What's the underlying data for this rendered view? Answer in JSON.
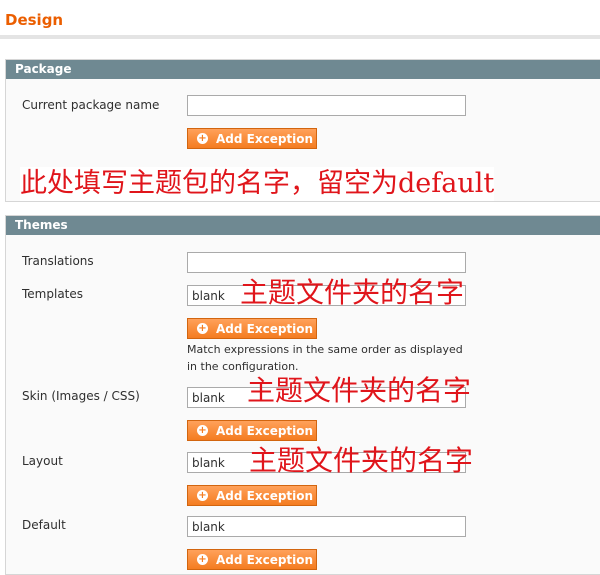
{
  "page": {
    "title": "Design"
  },
  "package_section": {
    "title": "Package",
    "current_package_label": "Current package name",
    "current_package_value": "",
    "add_exception_label": "Add Exception"
  },
  "themes_section": {
    "title": "Themes",
    "translations_label": "Translations",
    "translations_value": "",
    "templates_label": "Templates",
    "templates_value": "blank",
    "templates_hint": "Match expressions in the same order as displayed in the configuration.",
    "skin_label": "Skin (Images / CSS)",
    "skin_value": "blank",
    "layout_label": "Layout",
    "layout_value": "blank",
    "default_label": "Default",
    "default_value": "blank",
    "add_exception_label": "Add Exception"
  },
  "annotations": {
    "package_note": "此处填写主题包的名字，留空为default",
    "folder_note": "主题文件夹的名字"
  },
  "icons": {
    "add": "plus-circle-icon"
  },
  "colors": {
    "title": "#eb5e00",
    "header": "#6f8992",
    "button": "#f47c20",
    "annotation": "#e0151b"
  }
}
